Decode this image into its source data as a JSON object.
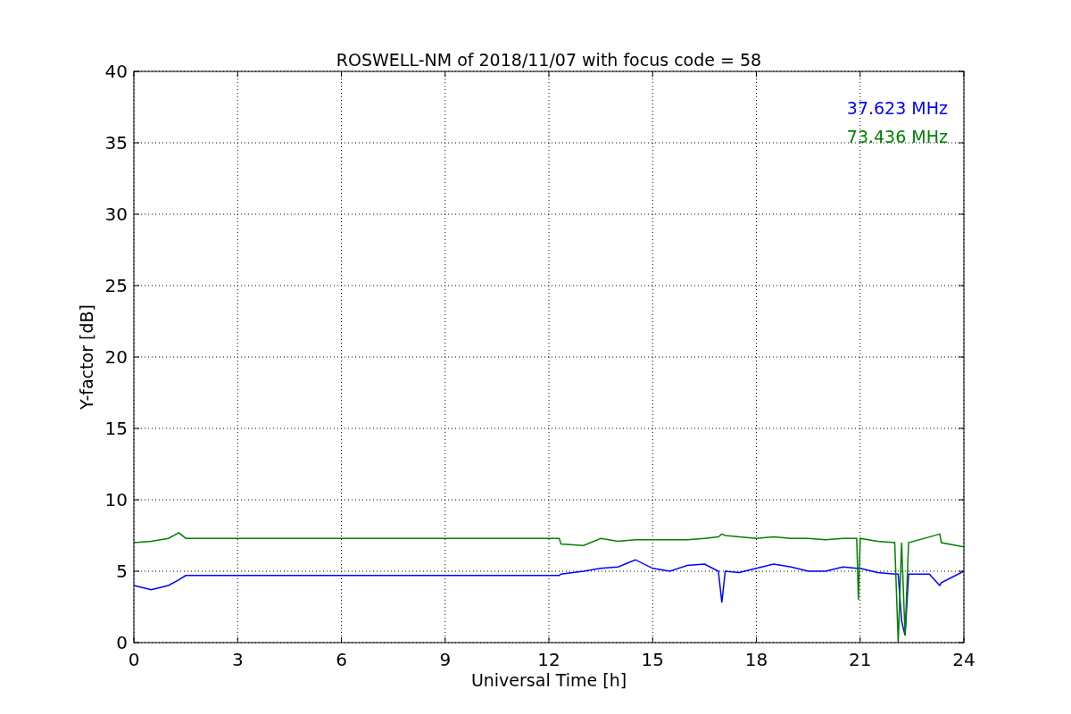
{
  "figure": {
    "chart_data": {
      "type": "line",
      "title": "ROSWELL-NM of 2018/11/07 with focus code = 58",
      "xlabel": "Universal Time [h]",
      "ylabel": "Y-factor [dB]",
      "x": [
        0,
        0.5,
        1,
        1.3,
        1.5,
        12.3,
        12.35,
        13,
        13.5,
        14,
        14.5,
        15,
        15.5,
        16,
        16.5,
        16.9,
        17,
        17.1,
        17.5,
        18,
        18.5,
        19,
        19.5,
        20,
        20.5,
        20.9,
        20.95,
        21,
        21.5,
        22,
        22.1,
        22.2,
        22.3,
        22.4,
        23,
        23.3,
        23.35,
        24
      ],
      "series": [
        {
          "name": "37.623 MHz",
          "color": "#0000ff",
          "values": [
            4.0,
            3.7,
            4.0,
            4.4,
            4.7,
            4.7,
            4.8,
            5.0,
            5.2,
            5.3,
            5.8,
            5.2,
            5.0,
            5.4,
            5.5,
            5.0,
            2.8,
            5.0,
            4.9,
            5.2,
            5.5,
            5.3,
            5.0,
            5.0,
            5.3,
            5.2,
            5.2,
            5.2,
            4.9,
            4.8,
            4.8,
            1.5,
            0.5,
            4.8,
            4.8,
            4.0,
            4.2,
            5.0
          ]
        },
        {
          "name": "73.436 MHz",
          "color": "#008000",
          "values": [
            7.0,
            7.1,
            7.3,
            7.7,
            7.3,
            7.3,
            6.9,
            6.8,
            7.3,
            7.1,
            7.2,
            7.2,
            7.2,
            7.2,
            7.3,
            7.4,
            7.6,
            7.5,
            7.4,
            7.3,
            7.4,
            7.3,
            7.3,
            7.2,
            7.3,
            7.3,
            3.0,
            7.3,
            7.1,
            7.0,
            0,
            7.0,
            0.5,
            7.0,
            7.4,
            7.6,
            7.0,
            6.7
          ]
        }
      ],
      "xlim": [
        0,
        24
      ],
      "ylim": [
        0,
        40
      ],
      "xticks": [
        0,
        3,
        6,
        9,
        12,
        15,
        18,
        21,
        24
      ],
      "yticks": [
        0,
        5,
        10,
        15,
        20,
        25,
        30,
        35,
        40
      ],
      "grid": true
    }
  }
}
